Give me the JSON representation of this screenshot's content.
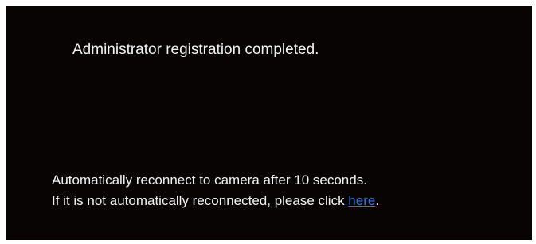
{
  "dialog": {
    "title": "Administrator registration completed.",
    "line1": "Automatically reconnect to camera after 10 seconds.",
    "line2_prefix": "If it is not automatically reconnected, please click ",
    "link_label": "here",
    "line2_suffix": "."
  },
  "colors": {
    "background": "#080404",
    "text": "#f2f2f2",
    "link": "#3b74d8"
  }
}
